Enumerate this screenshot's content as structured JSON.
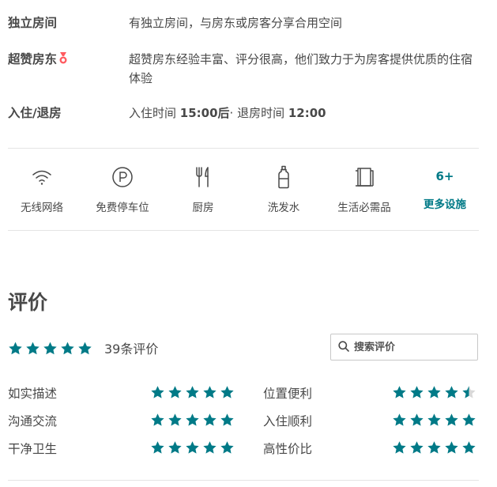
{
  "info": {
    "room": {
      "label": "独立房间",
      "value": "有独立房间，与房东或房客分享合用空间"
    },
    "superhost": {
      "label": "超赞房东",
      "badge_icon": "medal-icon",
      "value": "超赞房东经验丰富、评分很高，他们致力于为房客提供优质的住宿体验"
    },
    "checkin": {
      "label": "入住/退房",
      "prefix": "入住时间 ",
      "in_time": "15:00后",
      "middle": "· 退房时间 ",
      "out_time": "12:00"
    }
  },
  "amenities": [
    {
      "label": "无线网络",
      "icon": "wifi-icon"
    },
    {
      "label": "免费停车位",
      "icon": "parking-icon"
    },
    {
      "label": "厨房",
      "icon": "kitchen-icon"
    },
    {
      "label": "洗发水",
      "icon": "shampoo-icon"
    },
    {
      "label": "生活必需品",
      "icon": "essentials-icon"
    }
  ],
  "more_amenities": {
    "count": "6+",
    "label": "更多设施"
  },
  "reviews": {
    "title": "评价",
    "overall_rating": 5,
    "count_text": "39条评价",
    "search_placeholder": "搜索评价",
    "categories": [
      {
        "label": "如实描述",
        "rating": 5
      },
      {
        "label": "位置便利",
        "rating": 4.5
      },
      {
        "label": "沟通交流",
        "rating": 5
      },
      {
        "label": "入住顺利",
        "rating": 5
      },
      {
        "label": "干净卫生",
        "rating": 5
      },
      {
        "label": "高性价比",
        "rating": 5
      }
    ]
  },
  "colors": {
    "accent": "#007a87",
    "text": "#484848",
    "empty_star": "#d8d8d8"
  }
}
